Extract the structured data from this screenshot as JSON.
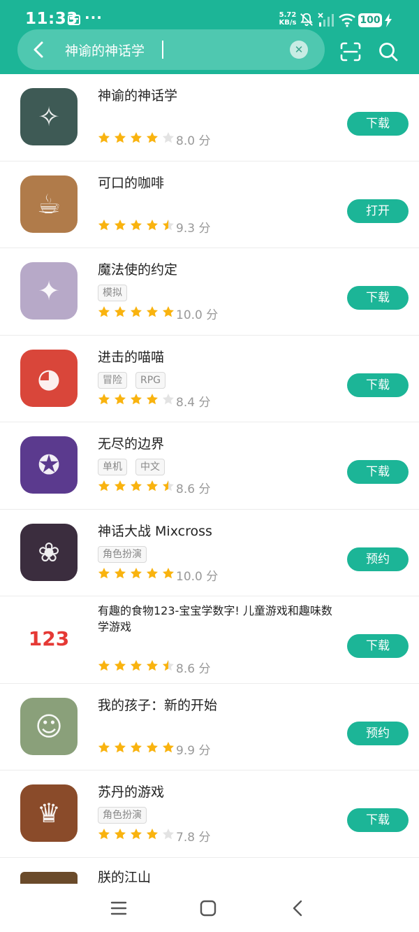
{
  "status_bar": {
    "time": "11:33",
    "more": "···",
    "net_speed_value": "5.72",
    "net_speed_unit": "KB/s",
    "battery": "100"
  },
  "search": {
    "query": "神谕的神话学",
    "clear_icon": "close-icon",
    "back_icon": "back-arrow-icon",
    "scan_icon": "scan-icon",
    "search_icon": "search-icon"
  },
  "colors": {
    "accent": "#1cb597",
    "star_filled": "#f9b30f",
    "star_empty": "#e3e3e3"
  },
  "apps": [
    {
      "title": "神谕的神话学",
      "tags": [],
      "rating": 4,
      "score": "8.0 分",
      "action": "下载",
      "icon_color": "#3e5a55",
      "icon_glyph": "✧"
    },
    {
      "title": "可口的咖啡",
      "tags": [],
      "rating": 4.5,
      "score": "9.3 分",
      "action": "打开",
      "icon_color": "#b07b4a",
      "icon_glyph": "☕"
    },
    {
      "title": "魔法使的约定",
      "tags": [
        "模拟"
      ],
      "rating": 5,
      "score": "10.0 分",
      "action": "下载",
      "icon_color": "#b7a9c8",
      "icon_glyph": "✦"
    },
    {
      "title": "进击的喵喵",
      "tags": [
        "冒险",
        "RPG"
      ],
      "rating": 4,
      "score": "8.4 分",
      "action": "下载",
      "icon_color": "#d9463a",
      "icon_glyph": "◕"
    },
    {
      "title": "无尽的边界",
      "tags": [
        "单机",
        "中文"
      ],
      "rating": 4.5,
      "score": "8.6 分",
      "action": "下载",
      "icon_color": "#5b3a8e",
      "icon_glyph": "✪"
    },
    {
      "title": "神话大战 Mixcross",
      "tags": [
        "角色扮演"
      ],
      "rating": 5,
      "score": "10.0 分",
      "action": "预约",
      "icon_color": "#3b2d3e",
      "icon_glyph": "❀"
    },
    {
      "title": "有趣的食物123-宝宝学数字! 儿童游戏和趣味数学游戏",
      "tags": [],
      "rating": 4.5,
      "score": "8.6 分",
      "action": "下载",
      "icon_color": "#ffffff",
      "icon_glyph": "123",
      "long": true
    },
    {
      "title": "我的孩子：新的开始",
      "tags": [],
      "rating": 5,
      "score": "9.9 分",
      "action": "预约",
      "icon_color": "#8aa07a",
      "icon_glyph": "☺"
    },
    {
      "title": "苏丹的游戏",
      "tags": [
        "角色扮演"
      ],
      "rating": 4,
      "score": "7.8 分",
      "action": "下载",
      "icon_color": "#8a4b2a",
      "icon_glyph": "♛"
    },
    {
      "title": "朕的江山",
      "tags": [],
      "rating": 0,
      "score": "",
      "action": "",
      "icon_color": "#6a4a2a",
      "icon_glyph": "",
      "partial": true
    }
  ],
  "nav_bar": {
    "menu_icon": "menu-icon",
    "home_icon": "home-icon",
    "back_icon": "back-icon"
  }
}
